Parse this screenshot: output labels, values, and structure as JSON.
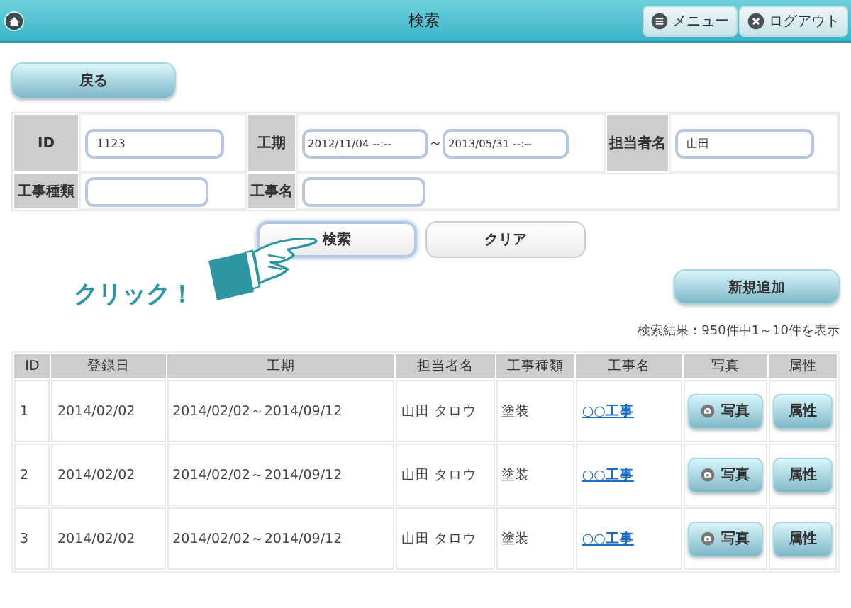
{
  "header": {
    "title": "検索",
    "buttons": [
      {
        "label": "メニュー",
        "kind": "menu"
      },
      {
        "label": "ログアウト",
        "kind": "logout"
      }
    ]
  },
  "back_button": "戻る",
  "search_form": {
    "id": {
      "label": "ID",
      "value": "1123"
    },
    "period": {
      "label": "工期",
      "from": "2012/11/04 --:--",
      "separator": "～",
      "to": "2013/05/31 --:--"
    },
    "person": {
      "label": "担当者名",
      "value": "山田"
    },
    "work_type": {
      "label": "工事種類"
    },
    "work_name": {
      "label": "工事名"
    }
  },
  "actions": [
    {
      "label": "検索",
      "focused": true
    },
    {
      "label": "クリア",
      "focused": false
    }
  ],
  "callout": "クリック！",
  "new_button": "新規追加",
  "result_summary": "検索結果：950件中1～10件を表示",
  "table": {
    "columns": [
      "ID",
      "登録日",
      "工期",
      "担当者名",
      "工事種類",
      "工事名",
      "写真",
      "属性"
    ],
    "rows": [
      {
        "id": "1",
        "registered": "2014/02/02",
        "period": "2014/02/02～2014/09/12",
        "person": "山田 タロウ",
        "work_type": "塗装",
        "work_name": "○○工事",
        "photo_button": "写真",
        "attr_button": "属性"
      },
      {
        "id": "2",
        "registered": "2014/02/02",
        "period": "2014/02/02～2014/09/12",
        "person": "山田 タロウ",
        "work_type": "塗装",
        "work_name": "○○工事",
        "photo_button": "写真",
        "attr_button": "属性"
      },
      {
        "id": "3",
        "registered": "2014/02/02",
        "period": "2014/02/02～2014/09/12",
        "person": "山田 タロウ",
        "work_type": "塗装",
        "work_name": "○○工事",
        "photo_button": "写真",
        "attr_button": "属性"
      }
    ]
  }
}
